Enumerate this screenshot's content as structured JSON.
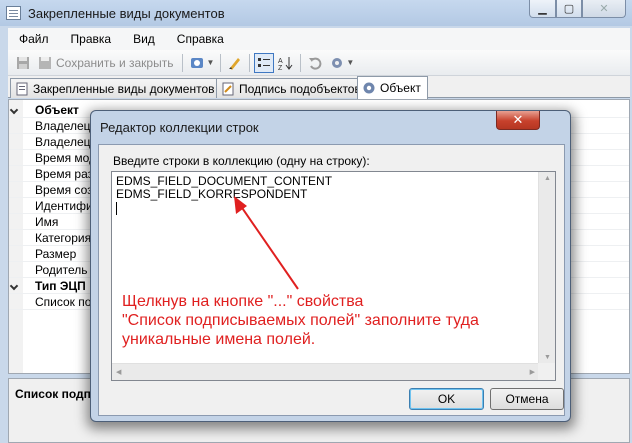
{
  "window": {
    "title": "Закрепленные виды документов",
    "controls": {
      "minimize": "▁",
      "maximize": "▢",
      "close": "✕"
    }
  },
  "menu": [
    "Файл",
    "Правка",
    "Вид",
    "Справка"
  ],
  "toolbar": {
    "save_close_label": "Сохранить и закрыть",
    "icons": [
      "floppy-icon",
      "save-close-icon",
      "template-icon",
      "sign-icon",
      "categorized-icon",
      "alphabetical-icon",
      "undo-icon",
      "settings-icon"
    ]
  },
  "tabs": [
    {
      "label": "Закрепленные виды документов"
    },
    {
      "label": "Подпись подобъектов"
    },
    {
      "label": "Объект"
    }
  ],
  "property_grid": {
    "rows": [
      {
        "label": "Объект",
        "category": true
      },
      {
        "label": "Владелец",
        "category": false
      },
      {
        "label": "Владелец",
        "category": false
      },
      {
        "label": "Время мод",
        "category": false
      },
      {
        "label": "Время раз",
        "category": false
      },
      {
        "label": "Время соз",
        "category": false
      },
      {
        "label": "Идентифи",
        "category": false
      },
      {
        "label": "Имя",
        "category": false
      },
      {
        "label": "Категория",
        "category": false
      },
      {
        "label": "Размер",
        "category": false
      },
      {
        "label": "Родитель",
        "category": false
      },
      {
        "label": "Тип ЭЦП",
        "category": true
      },
      {
        "label": "Список под",
        "category": false
      }
    ]
  },
  "description_panel": {
    "title": "Список подп"
  },
  "dialog": {
    "title": "Редактор коллекции строк",
    "close_glyph": "✕",
    "prompt": "Введите строки в коллекцию (одну на строку):",
    "lines": [
      "EDMS_FIELD_DOCUMENT_CONTENT",
      "EDMS_FIELD_KORRESPONDENT"
    ],
    "ok_label": "OK",
    "cancel_label": "Отмена"
  },
  "annotation": {
    "lines": [
      "Щелкнув на кнопке \"...\" свойства",
      "\"Список подписываемых полей\" заполните туда",
      "уникальные имена полей."
    ],
    "color": "#e02020"
  }
}
